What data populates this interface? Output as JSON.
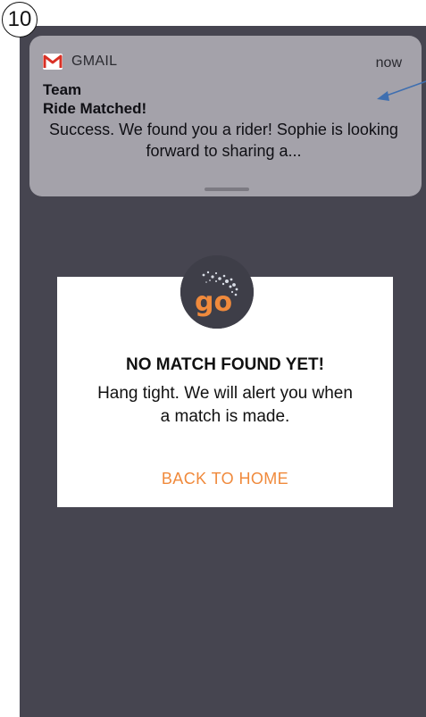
{
  "step_number": "10",
  "notification": {
    "app_name": "GMAIL",
    "time": "now",
    "sender": "Team",
    "subject": "Ride Matched!",
    "body": "Success. We found you a rider! Sophie is looking forward to sharing a...",
    "icon": "gmail-icon"
  },
  "modal": {
    "logo_text": "go",
    "title": "NO MATCH FOUND YET!",
    "message": "Hang tight. We will alert you when a match is made.",
    "button_label": "BACK TO HOME"
  },
  "colors": {
    "screen_background": "#464550",
    "notification_background": "#a4a2aa",
    "accent_orange": "#f08a3c",
    "annotation_arrow": "#3f6fb0"
  }
}
